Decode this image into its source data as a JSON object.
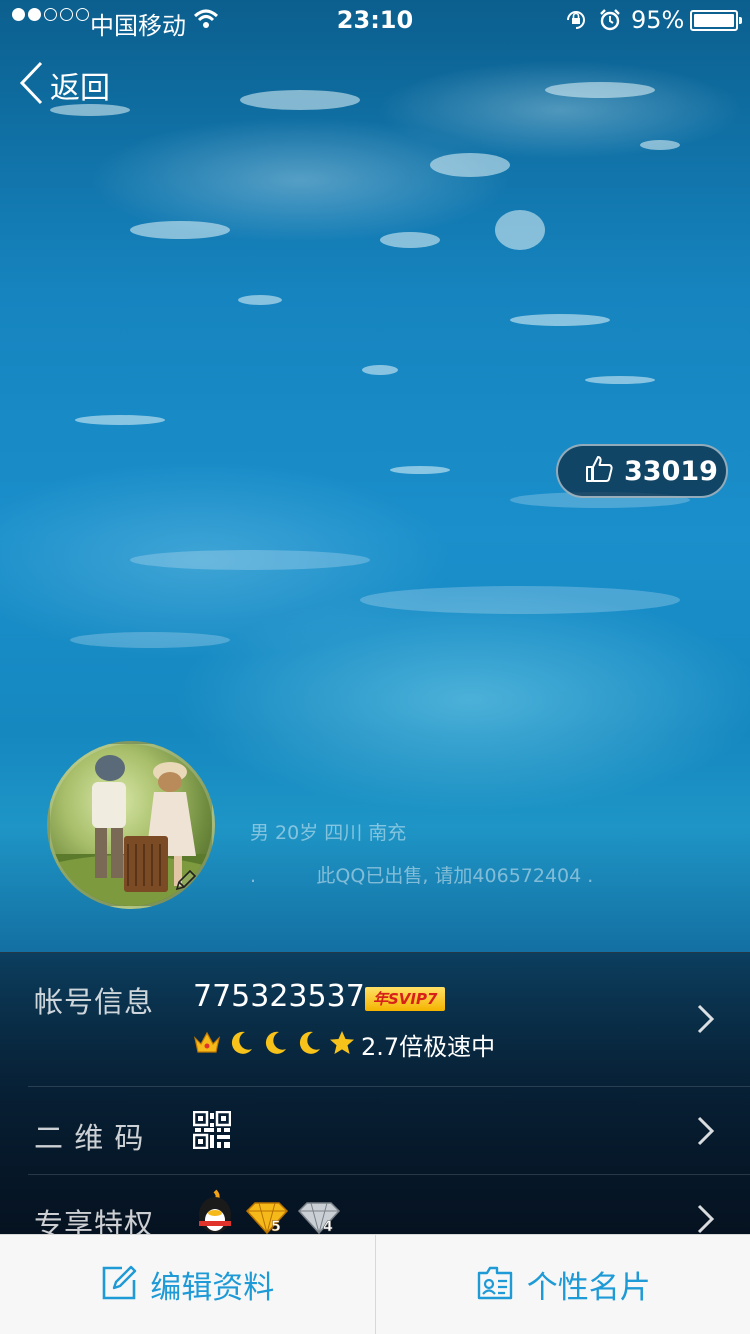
{
  "status_bar": {
    "carrier": "中国移动",
    "time": "23:10",
    "battery_percent": "95%",
    "battery_level": 0.95,
    "signal_bars_filled": 2,
    "signal_bars_total": 5,
    "icons": [
      "signal-dots-icon",
      "wifi-icon",
      "rotation-lock-icon",
      "alarm-icon",
      "battery-icon"
    ]
  },
  "nav": {
    "back_label": "返回",
    "back_icon": "chevron-left-icon"
  },
  "like": {
    "icon": "thumbs-up-icon",
    "count": "33019"
  },
  "profile": {
    "info": "男  20岁  四川 南充",
    "signature": ".          此QQ已出售, 请加406572404 .",
    "edit_icon": "pencil-icon"
  },
  "rows": {
    "account": {
      "label": "帐号信息",
      "number": "775323537",
      "badge": "年SVIP7",
      "level_icons": [
        "crown-icon",
        "moon-icon",
        "moon-icon",
        "moon-icon",
        "star-icon"
      ],
      "speed_text": "2.7倍极速中"
    },
    "qrcode": {
      "label": "二 维 码",
      "icon": "qr-code-icon"
    },
    "privilege": {
      "label": "专享特权",
      "icons": [
        "qq-penguin-icon",
        "gold-diamond-icon",
        "silver-diamond-icon"
      ],
      "gold_level": "5",
      "silver_level": "4"
    }
  },
  "bottom_bar": {
    "edit_label": "编辑资料",
    "edit_icon": "edit-icon",
    "card_label": "个性名片",
    "card_icon": "card-icon"
  },
  "colors": {
    "accent": "#1e9ad6",
    "svip_badge": "#f4b400",
    "bottom_bar_bg": "#f7f7f7"
  }
}
